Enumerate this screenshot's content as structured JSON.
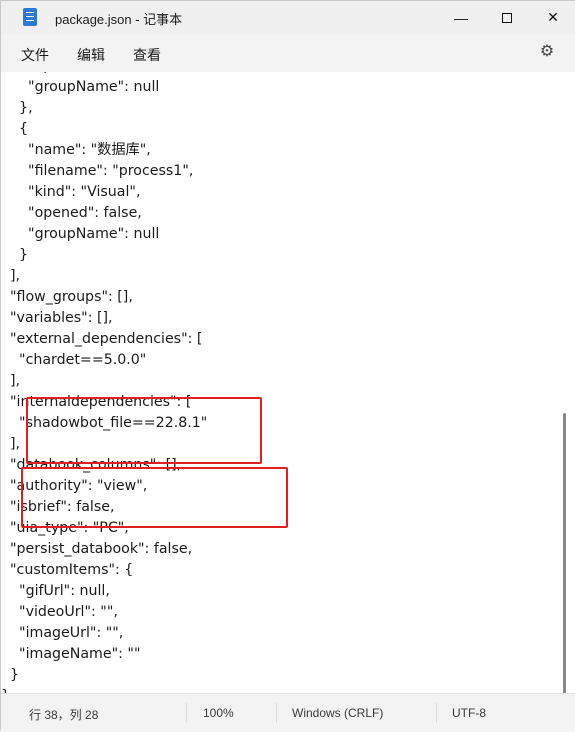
{
  "window": {
    "title": "package.json - 记事本",
    "minimize_label": "—",
    "close_label": "✕"
  },
  "menu": {
    "file": "文件",
    "edit": "编辑",
    "view": "查看",
    "settings_icon": "gear-icon"
  },
  "editor": {
    "lines": [
      "      \"opened\": false,",
      "      \"groupName\": null",
      "    },",
      "    {",
      "      \"name\": \"数据库\",",
      "      \"filename\": \"process1\",",
      "      \"kind\": \"Visual\",",
      "      \"opened\": false,",
      "      \"groupName\": null",
      "    }",
      "  ],",
      "  \"flow_groups\": [],",
      "  \"variables\": [],",
      "  \"external_dependencies\": [",
      "    \"chardet==5.0.0\"",
      "  ],",
      "  \"internaldependencies\": [",
      "    \"shadowbot_file==22.8.1\"",
      "  ],",
      "  \"databook_columns\": [],",
      "  \"authority\": \"view\",",
      "  \"isbrief\": false,",
      "  \"uia_type\": \"PC\",",
      "  \"persist_databook\": false,",
      "  \"customItems\": {",
      "    \"gifUrl\": null,",
      "    \"videoUrl\": \"\",",
      "    \"imageUrl\": \"\",",
      "    \"imageName\": \"\"",
      "  }",
      "}"
    ],
    "highlight_color": "#e02020"
  },
  "status": {
    "position": "行 38，列 28",
    "zoom": "100%",
    "line_ending": "Windows (CRLF)",
    "encoding": "UTF-8"
  }
}
